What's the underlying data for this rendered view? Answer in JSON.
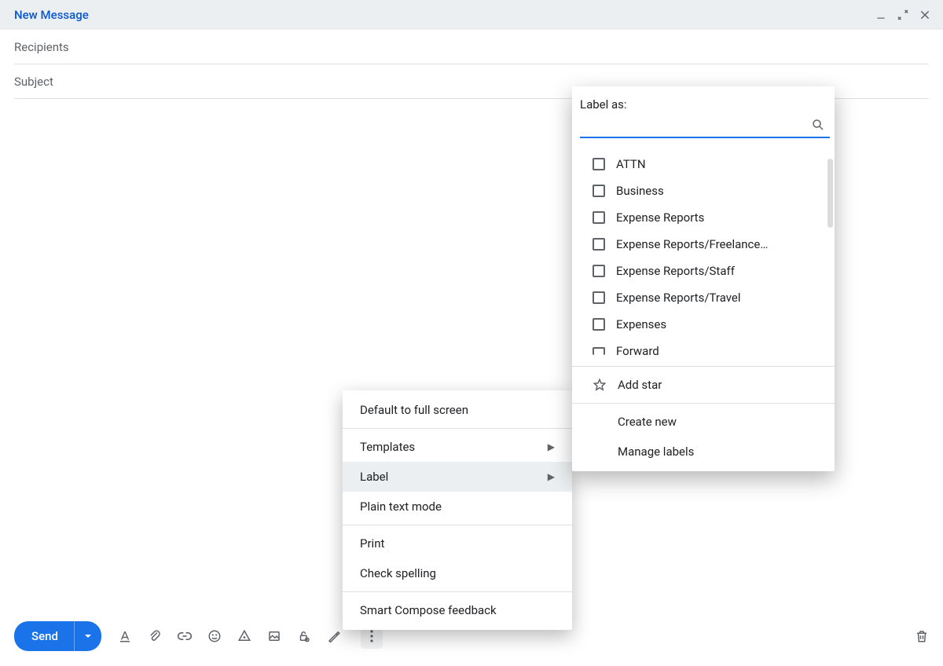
{
  "header": {
    "title": "New Message"
  },
  "fields": {
    "recipients_placeholder": "Recipients",
    "subject_placeholder": "Subject"
  },
  "send_label": "Send",
  "more_menu": {
    "default_full_screen": "Default to full screen",
    "templates": "Templates",
    "label": "Label",
    "plain_text": "Plain text mode",
    "print": "Print",
    "check_spelling": "Check spelling",
    "smart_compose_feedback": "Smart Compose feedback"
  },
  "label_panel": {
    "title": "Label as:",
    "search_value": "",
    "labels": [
      "ATTN",
      "Business",
      "Expense Reports",
      "Expense Reports/Freelance…",
      "Expense Reports/Staff",
      "Expense Reports/Travel",
      "Expenses",
      "Forward"
    ],
    "add_star": "Add star",
    "create_new": "Create new",
    "manage_labels": "Manage labels"
  }
}
